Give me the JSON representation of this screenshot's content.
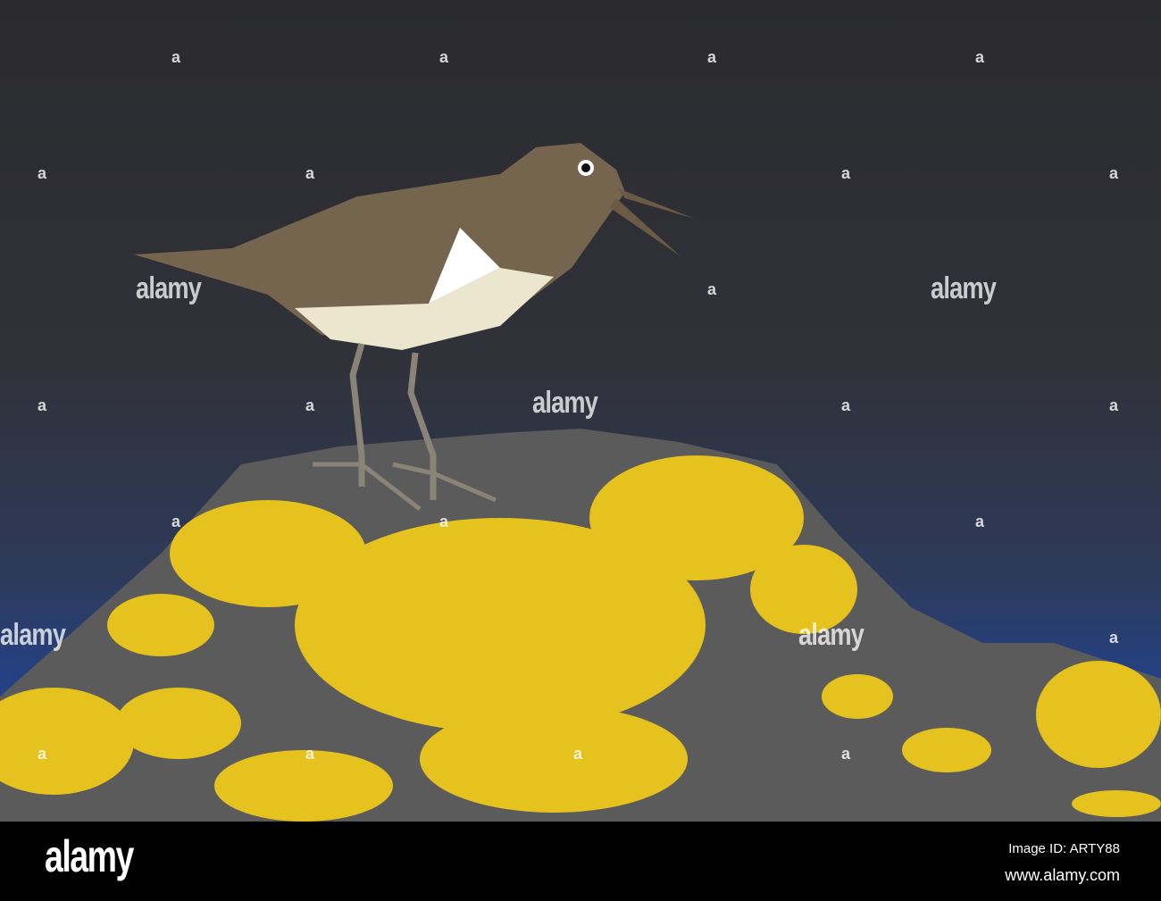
{
  "watermark": {
    "text": "alamy",
    "mark": "a"
  },
  "footer": {
    "logo": "alamy",
    "image_id": "Image ID: ARTY88",
    "website": "www.alamy.com"
  }
}
